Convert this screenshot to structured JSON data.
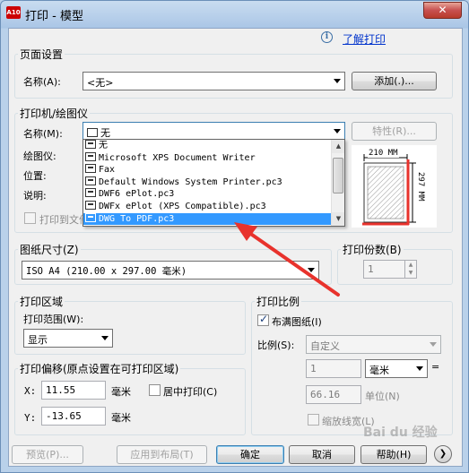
{
  "window": {
    "title": "打印 - 模型",
    "app_icon_text": "A10",
    "close_glyph": "✕",
    "help_link": "了解打印",
    "help_icon": "i"
  },
  "page_setup": {
    "group_label": "页面设置",
    "name_label": "名称(A):",
    "name_value": "<无>",
    "add_button": "添加(.)..."
  },
  "printer": {
    "group_label": "打印机/绘图仪",
    "name_label": "名称(M):",
    "name_value": "无",
    "properties_button": "特性(R)...",
    "plotter_label": "绘图仪:",
    "location_label": "位置:",
    "description_label": "说明:",
    "print_to_file_label": "打印到文件",
    "print_to_file_checked": false,
    "preview_width": "210 MM",
    "preview_height": "297 MM",
    "dropdown_items": [
      "无",
      "Microsoft XPS Document Writer",
      "Fax",
      "Default Windows System Printer.pc3",
      "DWF6 ePlot.pc3",
      "DWFx ePlot (XPS Compatible).pc3",
      "DWG To PDF.pc3"
    ],
    "dropdown_selected_index": 6
  },
  "paper_size": {
    "group_label": "图纸尺寸(Z)",
    "value": "ISO A4 (210.00 x 297.00 毫米)"
  },
  "copies": {
    "group_label": "打印份数(B)",
    "value": "1"
  },
  "plot_area": {
    "group_label": "打印区域",
    "range_label": "打印范围(W):",
    "range_value": "显示"
  },
  "plot_offset": {
    "group_label": "打印偏移(原点设置在可打印区域)",
    "x_label": "X:",
    "x_value": "11.55",
    "x_unit": "毫米",
    "y_label": "Y:",
    "y_value": "-13.65",
    "y_unit": "毫米",
    "center_label": "居中打印(C)",
    "center_checked": false
  },
  "plot_scale": {
    "group_label": "打印比例",
    "fit_label": "布满图纸(I)",
    "fit_checked": true,
    "scale_label": "比例(S):",
    "scale_value": "自定义",
    "value1": "1",
    "unit_value": "毫米",
    "equals": "=",
    "value2": "66.16",
    "unit2_label": "单位(N)",
    "lineweight_label": "缩放线宽(L)",
    "lineweight_checked": false
  },
  "footer": {
    "preview_button": "预览(P)...",
    "apply_button": "应用到布局(T)",
    "ok_button": "确定",
    "cancel_button": "取消",
    "help_button": "帮助(H)",
    "expand_glyph": "❯"
  },
  "watermark": "Bai du 经验",
  "colors": {
    "accent_red": "#e8322c",
    "selection_blue": "#3399ff",
    "link_blue": "#0033cc"
  }
}
